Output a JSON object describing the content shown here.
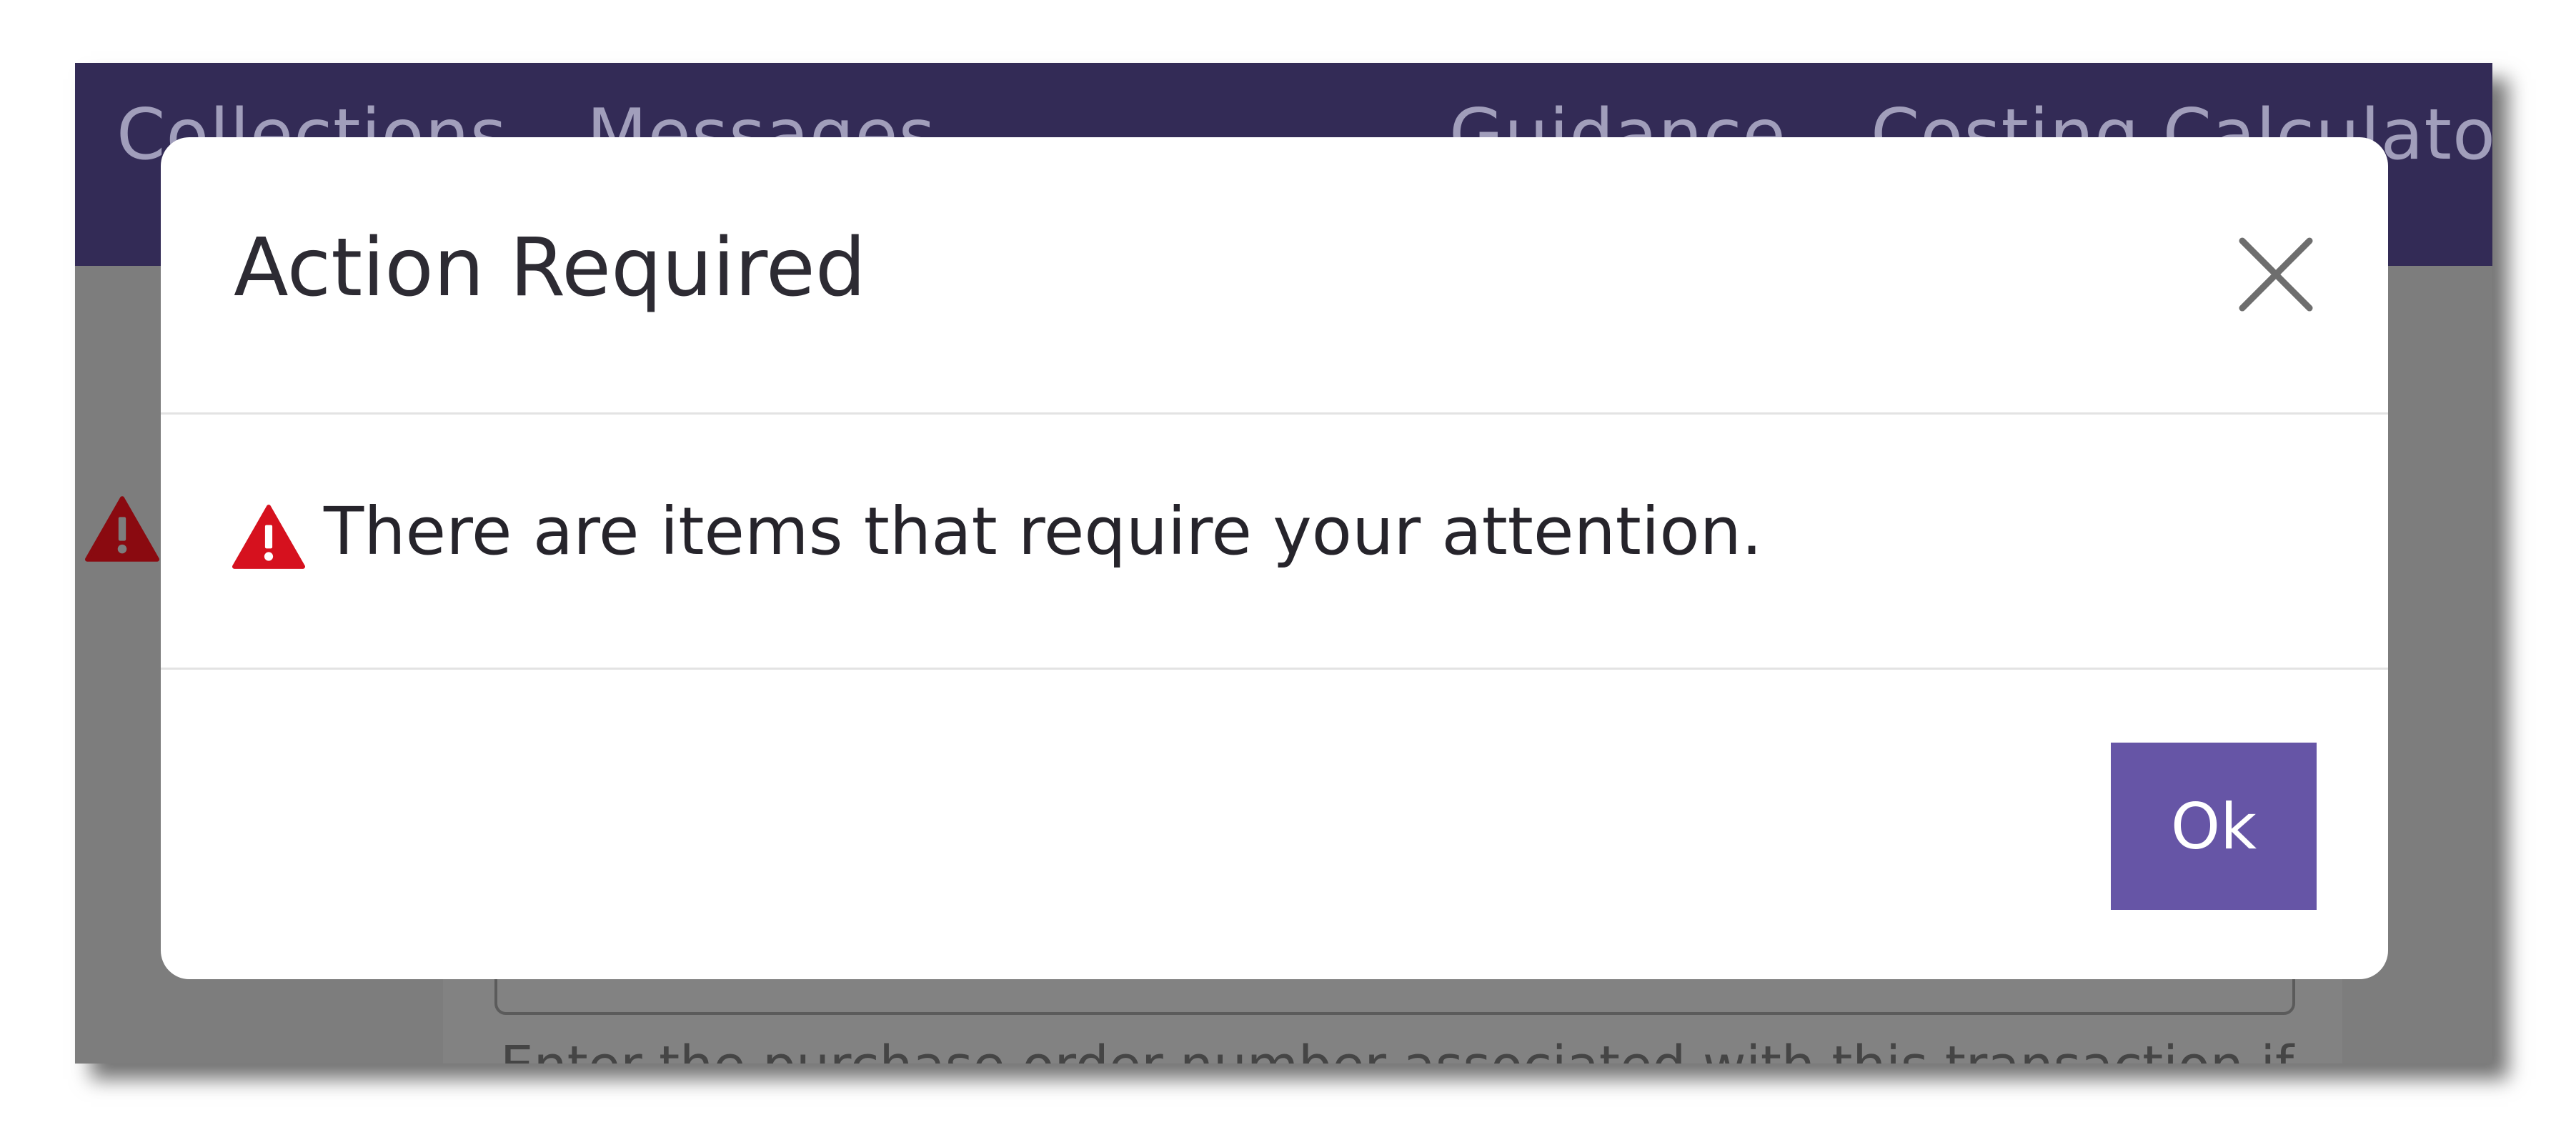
{
  "navbar": {
    "links": [
      "Collections",
      "Messages",
      "Guidance",
      "Costing Calculator"
    ]
  },
  "background": {
    "help_text": "Enter the purchase order number associated with this transaction if"
  },
  "modal": {
    "title": "Action Required",
    "close_icon": "close-icon",
    "warning_icon": "warning-triangle-icon",
    "message": "There are items that require your attention.",
    "ok_label": "Ok"
  },
  "colors": {
    "navbar": "#332b56",
    "primary_button": "#6655a6",
    "warning": "#d6111e",
    "overlay": "#7d7d7d"
  }
}
